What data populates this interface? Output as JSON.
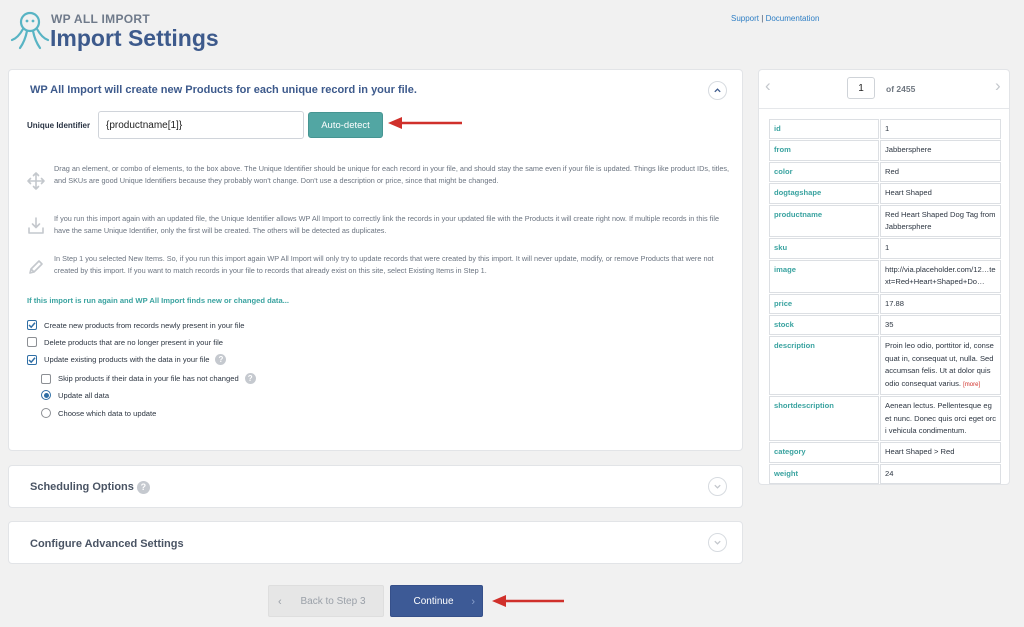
{
  "brand": {
    "small": "WP ALL IMPORT",
    "title": "Import Settings"
  },
  "links": {
    "support": "Support",
    "sep": "|",
    "docs": "Documentation"
  },
  "main": {
    "header": "WP All Import will create new Products for each unique record in your file.",
    "uid_label": "Unique Identifier",
    "uid_value": "{productname[1]}",
    "autodetect": "Auto-detect",
    "info": [
      {
        "icon": "move-arrows-icon",
        "text": "Drag an element, or combo of elements, to the box above. The Unique Identifier should be unique for each record in your file, and should stay the same even if your file is updated. Things like product IDs, titles, and SKUs are good Unique Identifiers because they probably won't change. Don't use a description or price, since that might be changed."
      },
      {
        "icon": "download-tray-icon",
        "text": "If you run this import again with an updated file, the Unique Identifier allows WP All Import to correctly link the records in your updated file with the Products it will create right now. If multiple records in this file have the same Unique Identifier, only the first will be created. The others will be detected as duplicates."
      },
      {
        "icon": "pencil-icon",
        "text": "In Step 1 you selected New Items. So, if you run this import again WP All Import will only try to update records that were created by this import. It will never update, modify, or remove Products that were not created by this import. If you want to match records in your file to records that already exist on this site, select Existing Items in Step 1."
      }
    ],
    "section_question": "If this import is run again and WP All Import finds new or changed data...",
    "options": {
      "create_new": "Create new products from records newly present in your file",
      "delete_missing": "Delete products that are no longer present in your file",
      "update_existing": "Update existing products with the data in your file",
      "skip_unchanged": "Skip products if their data in your file has not changed",
      "update_all": "Update all data",
      "choose_data": "Choose which data to update"
    }
  },
  "scheduling": {
    "title": "Scheduling Options"
  },
  "advanced": {
    "title": "Configure Advanced Settings"
  },
  "footer": {
    "back": "Back to Step 3",
    "continue": "Continue"
  },
  "record": {
    "current": "1",
    "total": "of 2455",
    "fields": [
      {
        "key": "id",
        "value": "1"
      },
      {
        "key": "from",
        "value": "Jabbersphere"
      },
      {
        "key": "color",
        "value": "Red"
      },
      {
        "key": "dogtagshape",
        "value": "Heart Shaped"
      },
      {
        "key": "productname",
        "value": "Red Heart Shaped Dog Tag from Jabbersphere"
      },
      {
        "key": "sku",
        "value": "1"
      },
      {
        "key": "image",
        "value": "http://via.placeholder.com/12…text=Red+Heart+Shaped+Do…"
      },
      {
        "key": "price",
        "value": "17.88"
      },
      {
        "key": "stock",
        "value": "35"
      },
      {
        "key": "description",
        "value": "Proin leo odio, porttitor id, consequat in, consequat ut, nulla. Sed accumsan felis. Ut at dolor quis odio consequat varius.",
        "more": "[more]"
      },
      {
        "key": "shortdescription",
        "value": "Aenean lectus. Pellentesque eget nunc. Donec quis orci eget orci vehicula condimentum."
      },
      {
        "key": "category",
        "value": "Heart Shaped > Red"
      },
      {
        "key": "weight",
        "value": "24"
      }
    ]
  },
  "colors": {
    "accent": "#3d5a8c",
    "teal": "#52a6a3",
    "arrow": "#d0302b"
  }
}
